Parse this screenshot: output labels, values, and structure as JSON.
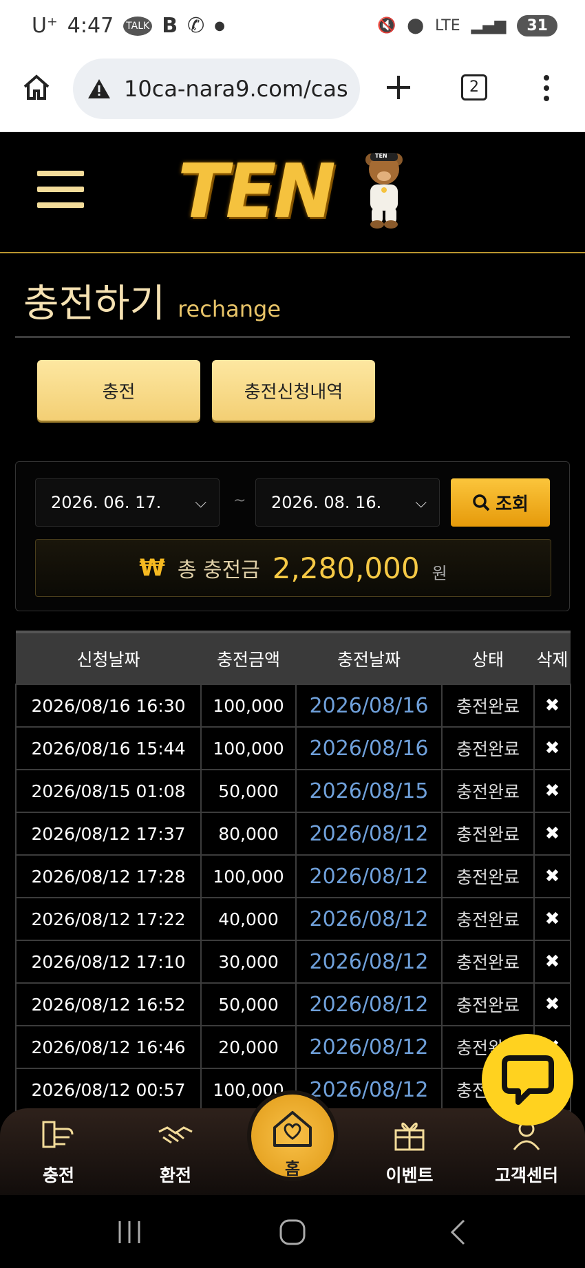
{
  "status_bar": {
    "carrier": "U⁺",
    "time": "4:47",
    "battery": "31",
    "network": "LTE"
  },
  "browser": {
    "url": "10ca-nara9.com/cas",
    "tab_count": "2"
  },
  "site": {
    "logo_text": "TEN",
    "bear_cap": "TEN"
  },
  "page": {
    "title_ko": "충전하기",
    "title_en": "rechange"
  },
  "tabs": {
    "charge": "충전",
    "history": "충전신청내역"
  },
  "filter": {
    "date_from": "2026. 06. 17.",
    "date_to": "2026. 08. 16.",
    "tilde": "~",
    "search_label": "조회",
    "total_currency": "₩",
    "total_label": "총 충전금",
    "total_amount": "2,280,000",
    "total_unit": "원"
  },
  "table": {
    "headers": [
      "신청날짜",
      "충전금액",
      "충전날짜",
      "상태",
      "삭제"
    ],
    "rows": [
      {
        "requested": "2026/08/16 16:30",
        "amount": "100,000",
        "charged": "2026/08/16",
        "status": "충전완료",
        "del": "✖"
      },
      {
        "requested": "2026/08/16 15:44",
        "amount": "100,000",
        "charged": "2026/08/16",
        "status": "충전완료",
        "del": "✖"
      },
      {
        "requested": "2026/08/15 01:08",
        "amount": "50,000",
        "charged": "2026/08/15",
        "status": "충전완료",
        "del": "✖"
      },
      {
        "requested": "2026/08/12 17:37",
        "amount": "80,000",
        "charged": "2026/08/12",
        "status": "충전완료",
        "del": "✖"
      },
      {
        "requested": "2026/08/12 17:28",
        "amount": "100,000",
        "charged": "2026/08/12",
        "status": "충전완료",
        "del": "✖"
      },
      {
        "requested": "2026/08/12 17:22",
        "amount": "40,000",
        "charged": "2026/08/12",
        "status": "충전완료",
        "del": "✖"
      },
      {
        "requested": "2026/08/12 17:10",
        "amount": "30,000",
        "charged": "2026/08/12",
        "status": "충전완료",
        "del": "✖"
      },
      {
        "requested": "2026/08/12 16:52",
        "amount": "50,000",
        "charged": "2026/08/12",
        "status": "충전완료",
        "del": "✖"
      },
      {
        "requested": "2026/08/12 16:46",
        "amount": "20,000",
        "charged": "2026/08/12",
        "status": "충전완료",
        "del": "✖"
      },
      {
        "requested": "2026/08/12 00:57",
        "amount": "100,000",
        "charged": "2026/08/12",
        "status": "충전완료",
        "del": "✖"
      }
    ]
  },
  "bottom_nav": {
    "charge": "충전",
    "exchange": "환전",
    "home": "홈",
    "event": "이벤트",
    "support": "고객센터"
  },
  "colors": {
    "accent": "#f5c23e",
    "link_date": "#6fa0da",
    "chat_fab": "#ffd21f"
  }
}
